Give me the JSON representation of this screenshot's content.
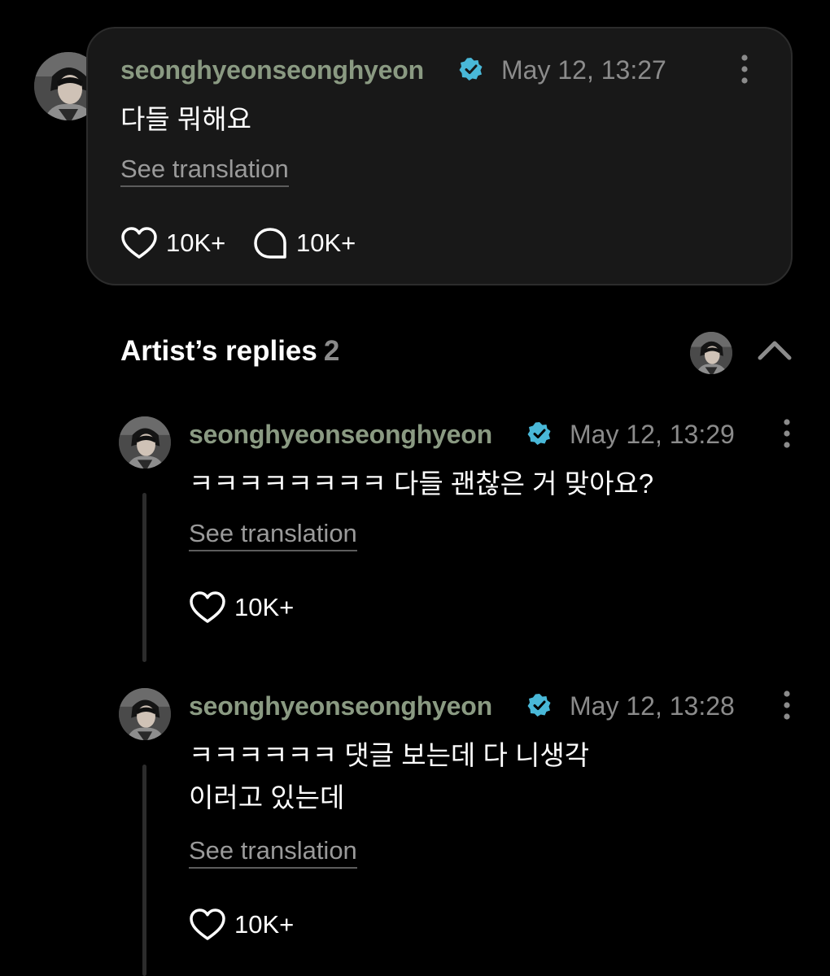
{
  "post": {
    "username": "seonghyeonseonghyeon",
    "timestamp": "May 12, 13:27",
    "text": "다들 뭐해요",
    "see_translation": "See translation",
    "likes": "10K+",
    "comments": "10K+"
  },
  "replies_section": {
    "title": "Artist’s replies",
    "count": "2"
  },
  "replies": [
    {
      "username": "seonghyeonseonghyeon",
      "timestamp": "May 12, 13:29",
      "text": "ㅋㅋㅋㅋㅋㅋㅋㅋ 다들 괜찮은 거 맞아요?",
      "see_translation": "See translation",
      "likes": "10K+"
    },
    {
      "username": "seonghyeonseonghyeon",
      "timestamp": "May 12, 13:28",
      "text_line1": "ㅋㅋㅋㅋㅋㅋ 댓글 보는데 다 니생각",
      "text_line2": "이러고 있는데",
      "see_translation": "See translation",
      "likes": "10K+"
    }
  ],
  "icons": {
    "verified": "verified-badge-icon",
    "more": "more-vertical-icon",
    "heart": "heart-icon",
    "comment": "comment-bubble-icon",
    "chevron": "chevron-up-icon"
  },
  "colors": {
    "background": "#000000",
    "card": "#181818",
    "username": "#8a9a82",
    "verified": "#49b8d8",
    "muted": "#8b8b8b"
  }
}
